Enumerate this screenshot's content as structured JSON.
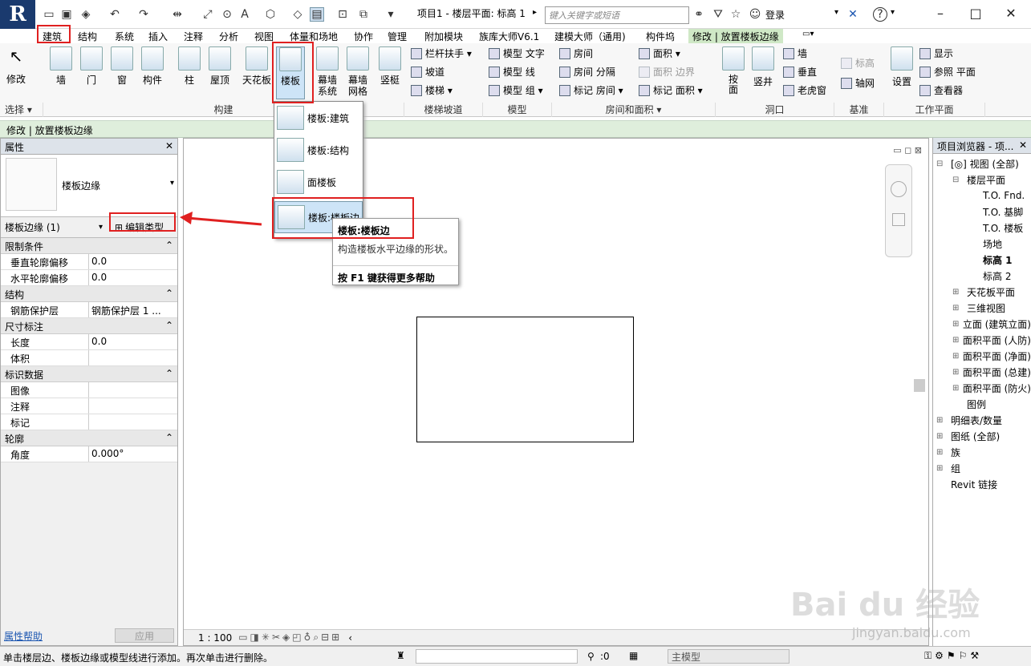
{
  "app": {
    "logo": "R",
    "title": "项目1 - 楼层平面: 标高 1",
    "search_placeholder": "键入关键字或短语",
    "login": "登录"
  },
  "tabs": [
    "建筑",
    "结构",
    "系统",
    "插入",
    "注释",
    "分析",
    "视图",
    "体量和场地",
    "协作",
    "管理",
    "附加模块",
    "族库大师V6.1",
    "建模大师（通用)",
    "构件坞",
    "修改 | 放置楼板边缘"
  ],
  "ribbon": {
    "modify": "修改",
    "select": "选择 ▾",
    "build_buttons": [
      "墙",
      "门",
      "窗",
      "构件",
      "柱",
      "屋顶",
      "天花板",
      "楼板",
      "幕墙\n系统",
      "幕墙\n网格",
      "竖梃"
    ],
    "build_label": "构建",
    "stair": [
      "栏杆扶手 ▾",
      "坡道",
      "楼梯 ▾"
    ],
    "stair_label": "楼梯坡道",
    "model": [
      "模型 文字",
      "模型 线",
      "模型 组 ▾"
    ],
    "model_label": "模型",
    "room": [
      "房间",
      "房间 分隔",
      "标记 房间 ▾"
    ],
    "area": [
      "面积 ▾",
      "面积 边界",
      "标记 面积 ▾"
    ],
    "room_label": "房间和面积 ▾",
    "opening": [
      "按\n面",
      "竖井",
      "墙",
      "垂直",
      "老虎窗"
    ],
    "opening_label": "洞口",
    "datum": [
      "标高",
      "轴网"
    ],
    "datum_label": "基准",
    "work": [
      "设置",
      "显示",
      "参照 平面",
      "查看器"
    ],
    "work_label": "工作平面"
  },
  "context": "修改 | 放置楼板边缘",
  "dropdown": [
    "楼板:建筑",
    "楼板:结构",
    "面楼板",
    "楼板:楼板边"
  ],
  "tooltip": {
    "title": "楼板:楼板边",
    "desc": "构造楼板水平边缘的形状。",
    "help": "按 F1 键获得更多帮助"
  },
  "props": {
    "title": "属性",
    "type_name": "楼板边缘",
    "instance": "楼板边缘 (1)",
    "edit_type": "编辑类型",
    "sections": [
      {
        "name": "限制条件",
        "rows": [
          [
            "垂直轮廓偏移",
            "0.0"
          ],
          [
            "水平轮廓偏移",
            "0.0"
          ]
        ]
      },
      {
        "name": "结构",
        "rows": [
          [
            "钢筋保护层",
            "钢筋保护层 1 ..."
          ]
        ]
      },
      {
        "name": "尺寸标注",
        "rows": [
          [
            "长度",
            "0.0"
          ],
          [
            "体积",
            ""
          ]
        ]
      },
      {
        "name": "标识数据",
        "rows": [
          [
            "图像",
            ""
          ],
          [
            "注释",
            ""
          ],
          [
            "标记",
            ""
          ]
        ]
      },
      {
        "name": "轮廓",
        "rows": [
          [
            "角度",
            "0.000°"
          ]
        ]
      }
    ],
    "help": "属性帮助",
    "apply": "应用"
  },
  "browser": {
    "title": "项目浏览器 - 项...",
    "items": [
      "[◎] 视图 (全部)",
      "楼层平面",
      "T.O. Fnd.",
      "T.O. 基脚",
      "T.O. 楼板",
      "场地",
      "标高 1",
      "标高 2",
      "天花板平面",
      "三维视图",
      "立面 (建筑立面)",
      "面积平面 (人防)",
      "面积平面 (净面)",
      "面积平面 (总建)",
      "面积平面 (防火)",
      "图例",
      "明细表/数量",
      "图纸 (全部)",
      "族",
      "组",
      "Revit 链接"
    ]
  },
  "view": {
    "scale": "1 : 100"
  },
  "status": {
    "text": "单击楼层边、楼板边缘或模型线进行添加。再次单击进行删除。",
    "count": ":0",
    "model": "主模型"
  },
  "watermark": {
    "brand": "Bai du 经验",
    "url": "jingyan.baidu.com"
  }
}
